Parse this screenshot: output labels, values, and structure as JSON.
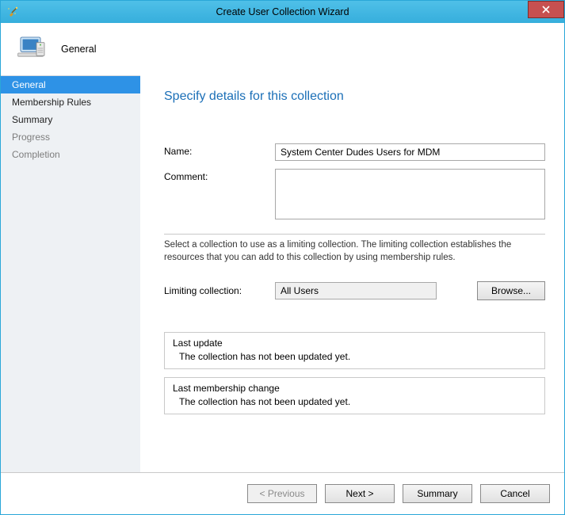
{
  "window": {
    "title": "Create User Collection Wizard"
  },
  "header": {
    "page": "General"
  },
  "sidebar": {
    "items": [
      {
        "label": "General",
        "state": "selected"
      },
      {
        "label": "Membership Rules",
        "state": "normal"
      },
      {
        "label": "Summary",
        "state": "normal"
      },
      {
        "label": "Progress",
        "state": "inactive"
      },
      {
        "label": "Completion",
        "state": "inactive"
      }
    ]
  },
  "main": {
    "heading": "Specify details for this collection",
    "name_label": "Name:",
    "name_value": "System Center Dudes Users for MDM",
    "comment_label": "Comment:",
    "comment_value": "",
    "help_text": "Select a collection to use as a limiting collection. The limiting collection establishes the resources that you can add to this collection by using membership rules.",
    "limiting_label": "Limiting collection:",
    "limiting_value": "All Users",
    "browse_label": "Browse...",
    "last_update_legend": "Last update",
    "last_update_value": "The collection has not been updated yet.",
    "last_membership_legend": "Last membership change",
    "last_membership_value": "The collection has not been updated yet."
  },
  "footer": {
    "previous": "< Previous",
    "next": "Next >",
    "summary": "Summary",
    "cancel": "Cancel"
  }
}
